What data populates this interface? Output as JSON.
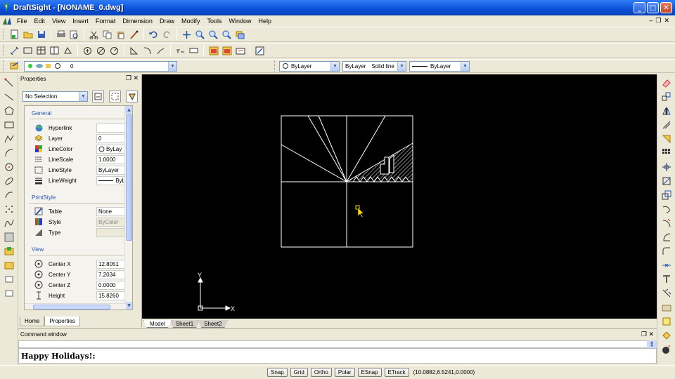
{
  "window": {
    "title": "DraftSight - [NONAME_0.dwg]"
  },
  "menu": {
    "items": [
      "File",
      "Edit",
      "View",
      "Insert",
      "Format",
      "Dimension",
      "Draw",
      "Modify",
      "Tools",
      "Window",
      "Help"
    ]
  },
  "layer_bar": {
    "layer_value": "0",
    "color": "ByLayer",
    "linetype_layer": "ByLayer",
    "linetype": "Solid line",
    "lineweight": "ByLayer"
  },
  "properties": {
    "title": "Properties",
    "selection": "No Selection",
    "general": {
      "heading": "General",
      "rows": [
        {
          "label": "Hyperlink",
          "value": ""
        },
        {
          "label": "Layer",
          "value": "0"
        },
        {
          "label": "LineColor",
          "value": "ByLay"
        },
        {
          "label": "LineScale",
          "value": "1.0000"
        },
        {
          "label": "LineStyle",
          "value": "ByLayer"
        },
        {
          "label": "LineWeight",
          "value": "ByL"
        }
      ]
    },
    "printstyle": {
      "heading": "PrintStyle",
      "rows": [
        {
          "label": "Table",
          "value": "None"
        },
        {
          "label": "Style",
          "value": "ByColor"
        },
        {
          "label": "Type",
          "value": ""
        }
      ]
    },
    "view": {
      "heading": "View",
      "rows": [
        {
          "label": "Center X",
          "value": "12.8051"
        },
        {
          "label": "Center Y",
          "value": "7.2034"
        },
        {
          "label": "Center Z",
          "value": "0.0000"
        },
        {
          "label": "Height",
          "value": "15.8260"
        }
      ]
    },
    "tabs": [
      "Home",
      "Properties"
    ]
  },
  "sheets": [
    "Model",
    "Sheet1",
    "Sheet2"
  ],
  "axes": {
    "y": "Y",
    "x": "X"
  },
  "command": {
    "title": "Command window",
    "input": "Happy Holidays!:"
  },
  "status": {
    "buttons": [
      "Snap",
      "Grid",
      "Ortho",
      "Polar",
      "ESnap",
      "ETrack"
    ],
    "coords": "(10.0882,6.5241,0.0000)"
  },
  "colors": {
    "title_bar": "#0a4fd8",
    "canvas": "#000000",
    "drawing": "#ffffff",
    "cursor": "#ffd700",
    "panel": "#ece9d8"
  }
}
